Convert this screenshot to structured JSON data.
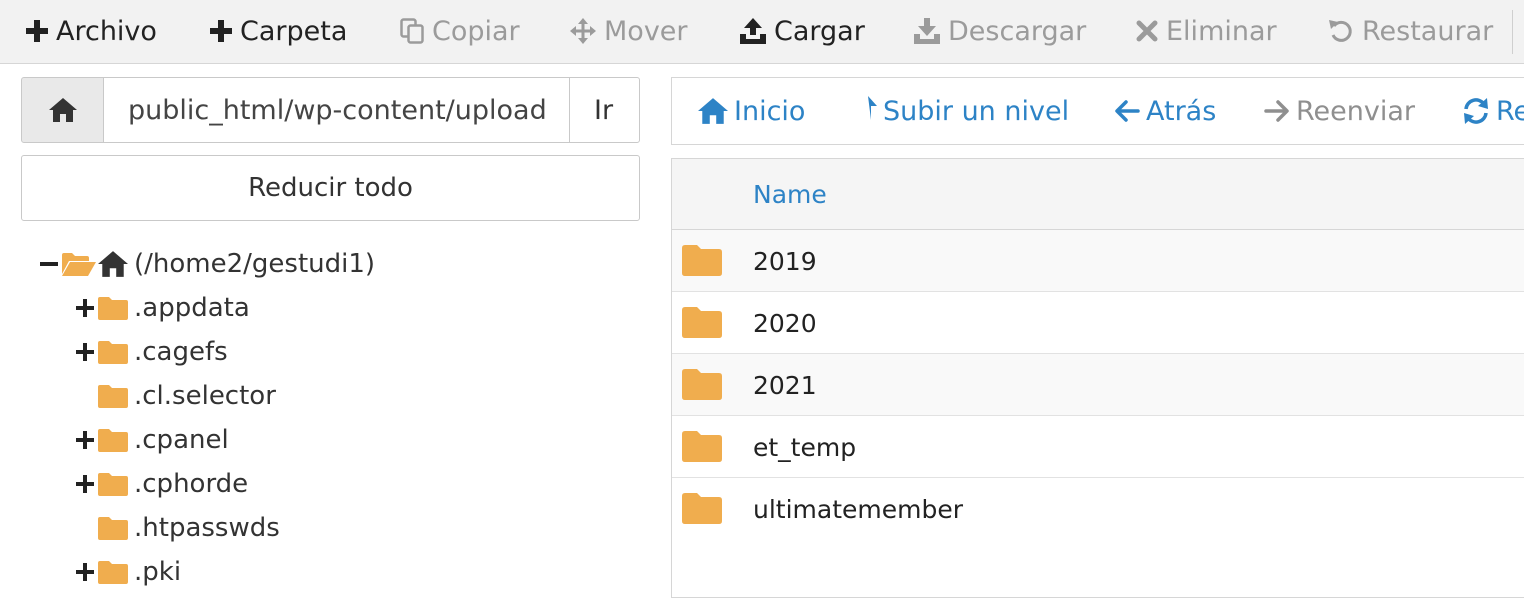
{
  "toolbar": {
    "file": "Archivo",
    "folder": "Carpeta",
    "copy": "Copiar",
    "move": "Mover",
    "upload": "Cargar",
    "download": "Descargar",
    "delete": "Eliminar",
    "restore": "Restaurar"
  },
  "path_bar": {
    "value": "public_html/wp-content/uploads",
    "go_label": "Ir"
  },
  "tree": {
    "collapse_label": "Reducir todo",
    "root_label": "(/home2/gestudi1)",
    "items": [
      {
        "label": ".appdata",
        "expandable": true
      },
      {
        "label": ".cagefs",
        "expandable": true
      },
      {
        "label": ".cl.selector",
        "expandable": false
      },
      {
        "label": ".cpanel",
        "expandable": true
      },
      {
        "label": ".cphorde",
        "expandable": true
      },
      {
        "label": ".htpasswds",
        "expandable": false
      },
      {
        "label": ".pki",
        "expandable": true
      }
    ]
  },
  "nav": {
    "home": "Inicio",
    "up": "Subir un nivel",
    "back": "Atrás",
    "forward": "Reenviar",
    "reload": "Re"
  },
  "files": {
    "column_name": "Name",
    "rows": [
      "2019",
      "2020",
      "2021",
      "et_temp",
      "ultimatemember"
    ]
  },
  "colors": {
    "accent": "#2d83c6",
    "folder": "#f0ad4e",
    "disabled": "#9b9b9b"
  },
  "icons": {
    "file": "plus-icon",
    "folder": "plus-icon",
    "copy": "copy-icon",
    "move": "arrows-move-icon",
    "upload": "upload-icon",
    "download": "download-icon",
    "delete": "x-icon",
    "restore": "undo-icon",
    "home": "home-icon",
    "up": "level-up-icon",
    "back": "arrow-left-icon",
    "forward": "arrow-right-icon",
    "reload": "refresh-icon",
    "tree_folder": "folder-icon",
    "tree_folder_open": "folder-open-icon"
  }
}
